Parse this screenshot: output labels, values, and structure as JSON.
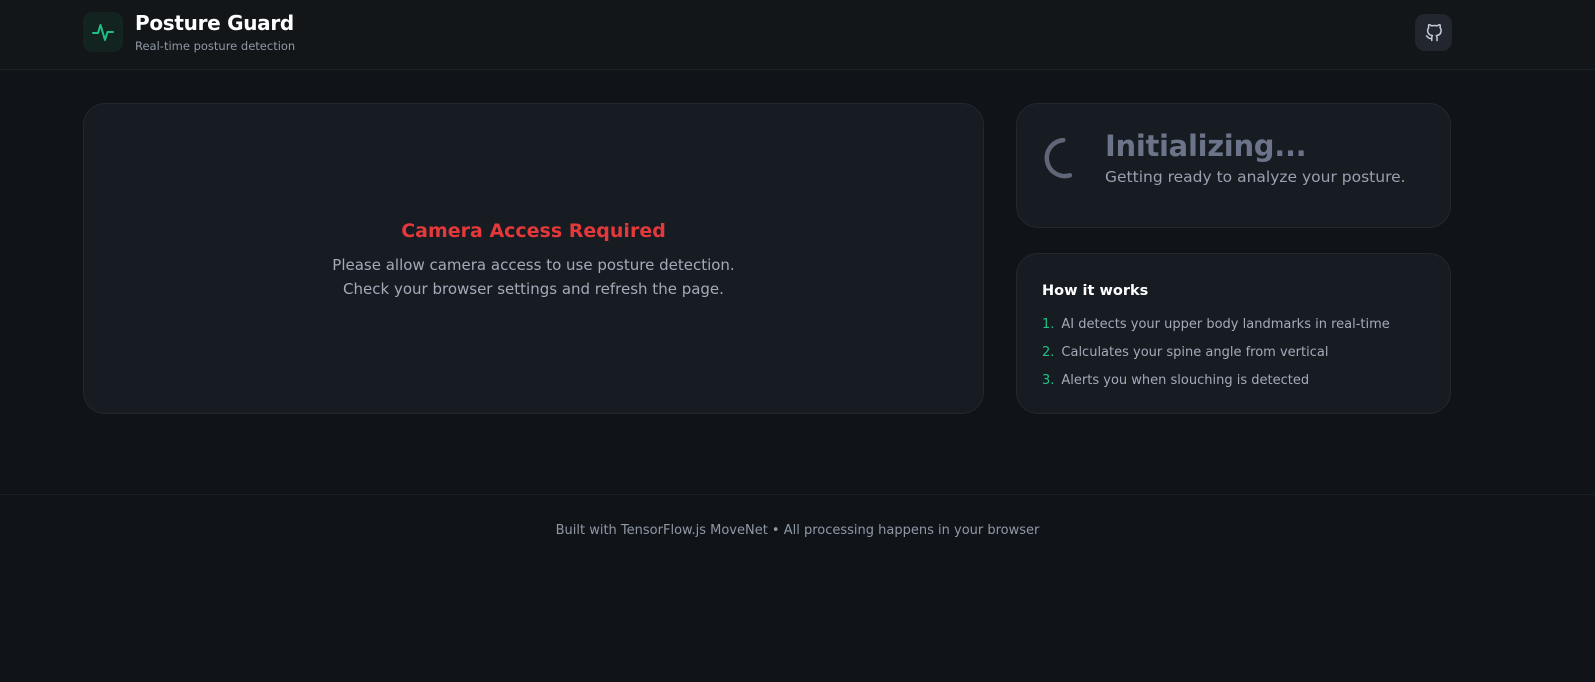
{
  "header": {
    "title": "Posture Guard",
    "subtitle": "Real-time posture detection",
    "logo_icon": "activity-pulse-icon",
    "github_icon": "github-icon"
  },
  "camera": {
    "title": "Camera Access Required",
    "message_line1": "Please allow camera access to use posture detection.",
    "message_line2": "Check your browser settings and refresh the page."
  },
  "status": {
    "title": "Initializing...",
    "subtitle": "Getting ready to analyze your posture.",
    "icon": "loading-spinner-icon"
  },
  "how_it_works": {
    "title": "How it works",
    "steps": [
      {
        "num": "1.",
        "text": "AI detects your upper body landmarks in real-time"
      },
      {
        "num": "2.",
        "text": "Calculates your spine angle from vertical"
      },
      {
        "num": "3.",
        "text": "Alerts you when slouching is detected"
      }
    ]
  },
  "footer": {
    "text": "Built with TensorFlow.js MoveNet • All processing happens in your browser"
  },
  "colors": {
    "background": "#101418",
    "card": "#171b22",
    "accent_green": "#1fbf85",
    "error_red": "#e5383b",
    "muted_text": "#a3abb8"
  }
}
